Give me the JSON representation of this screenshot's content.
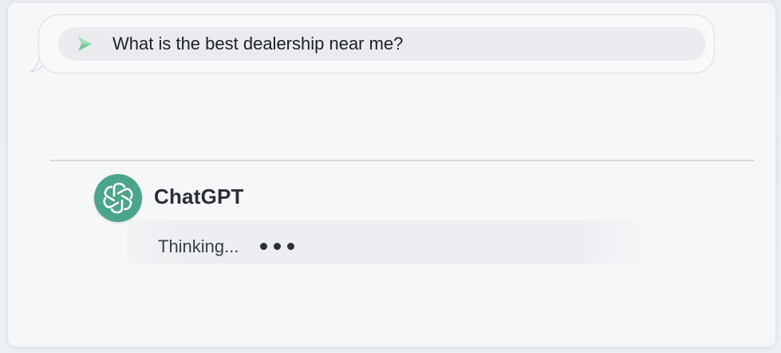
{
  "prompt": {
    "text": "What is the best dealership near me?",
    "icon": "send-arrow-icon",
    "icon_color": "#7cc79a"
  },
  "response": {
    "bot_name": "ChatGPT",
    "avatar_icon": "chatgpt-logo-icon",
    "avatar_color": "#4aa58a",
    "status_text": "Thinking...",
    "typing_indicator": "three-dots"
  }
}
